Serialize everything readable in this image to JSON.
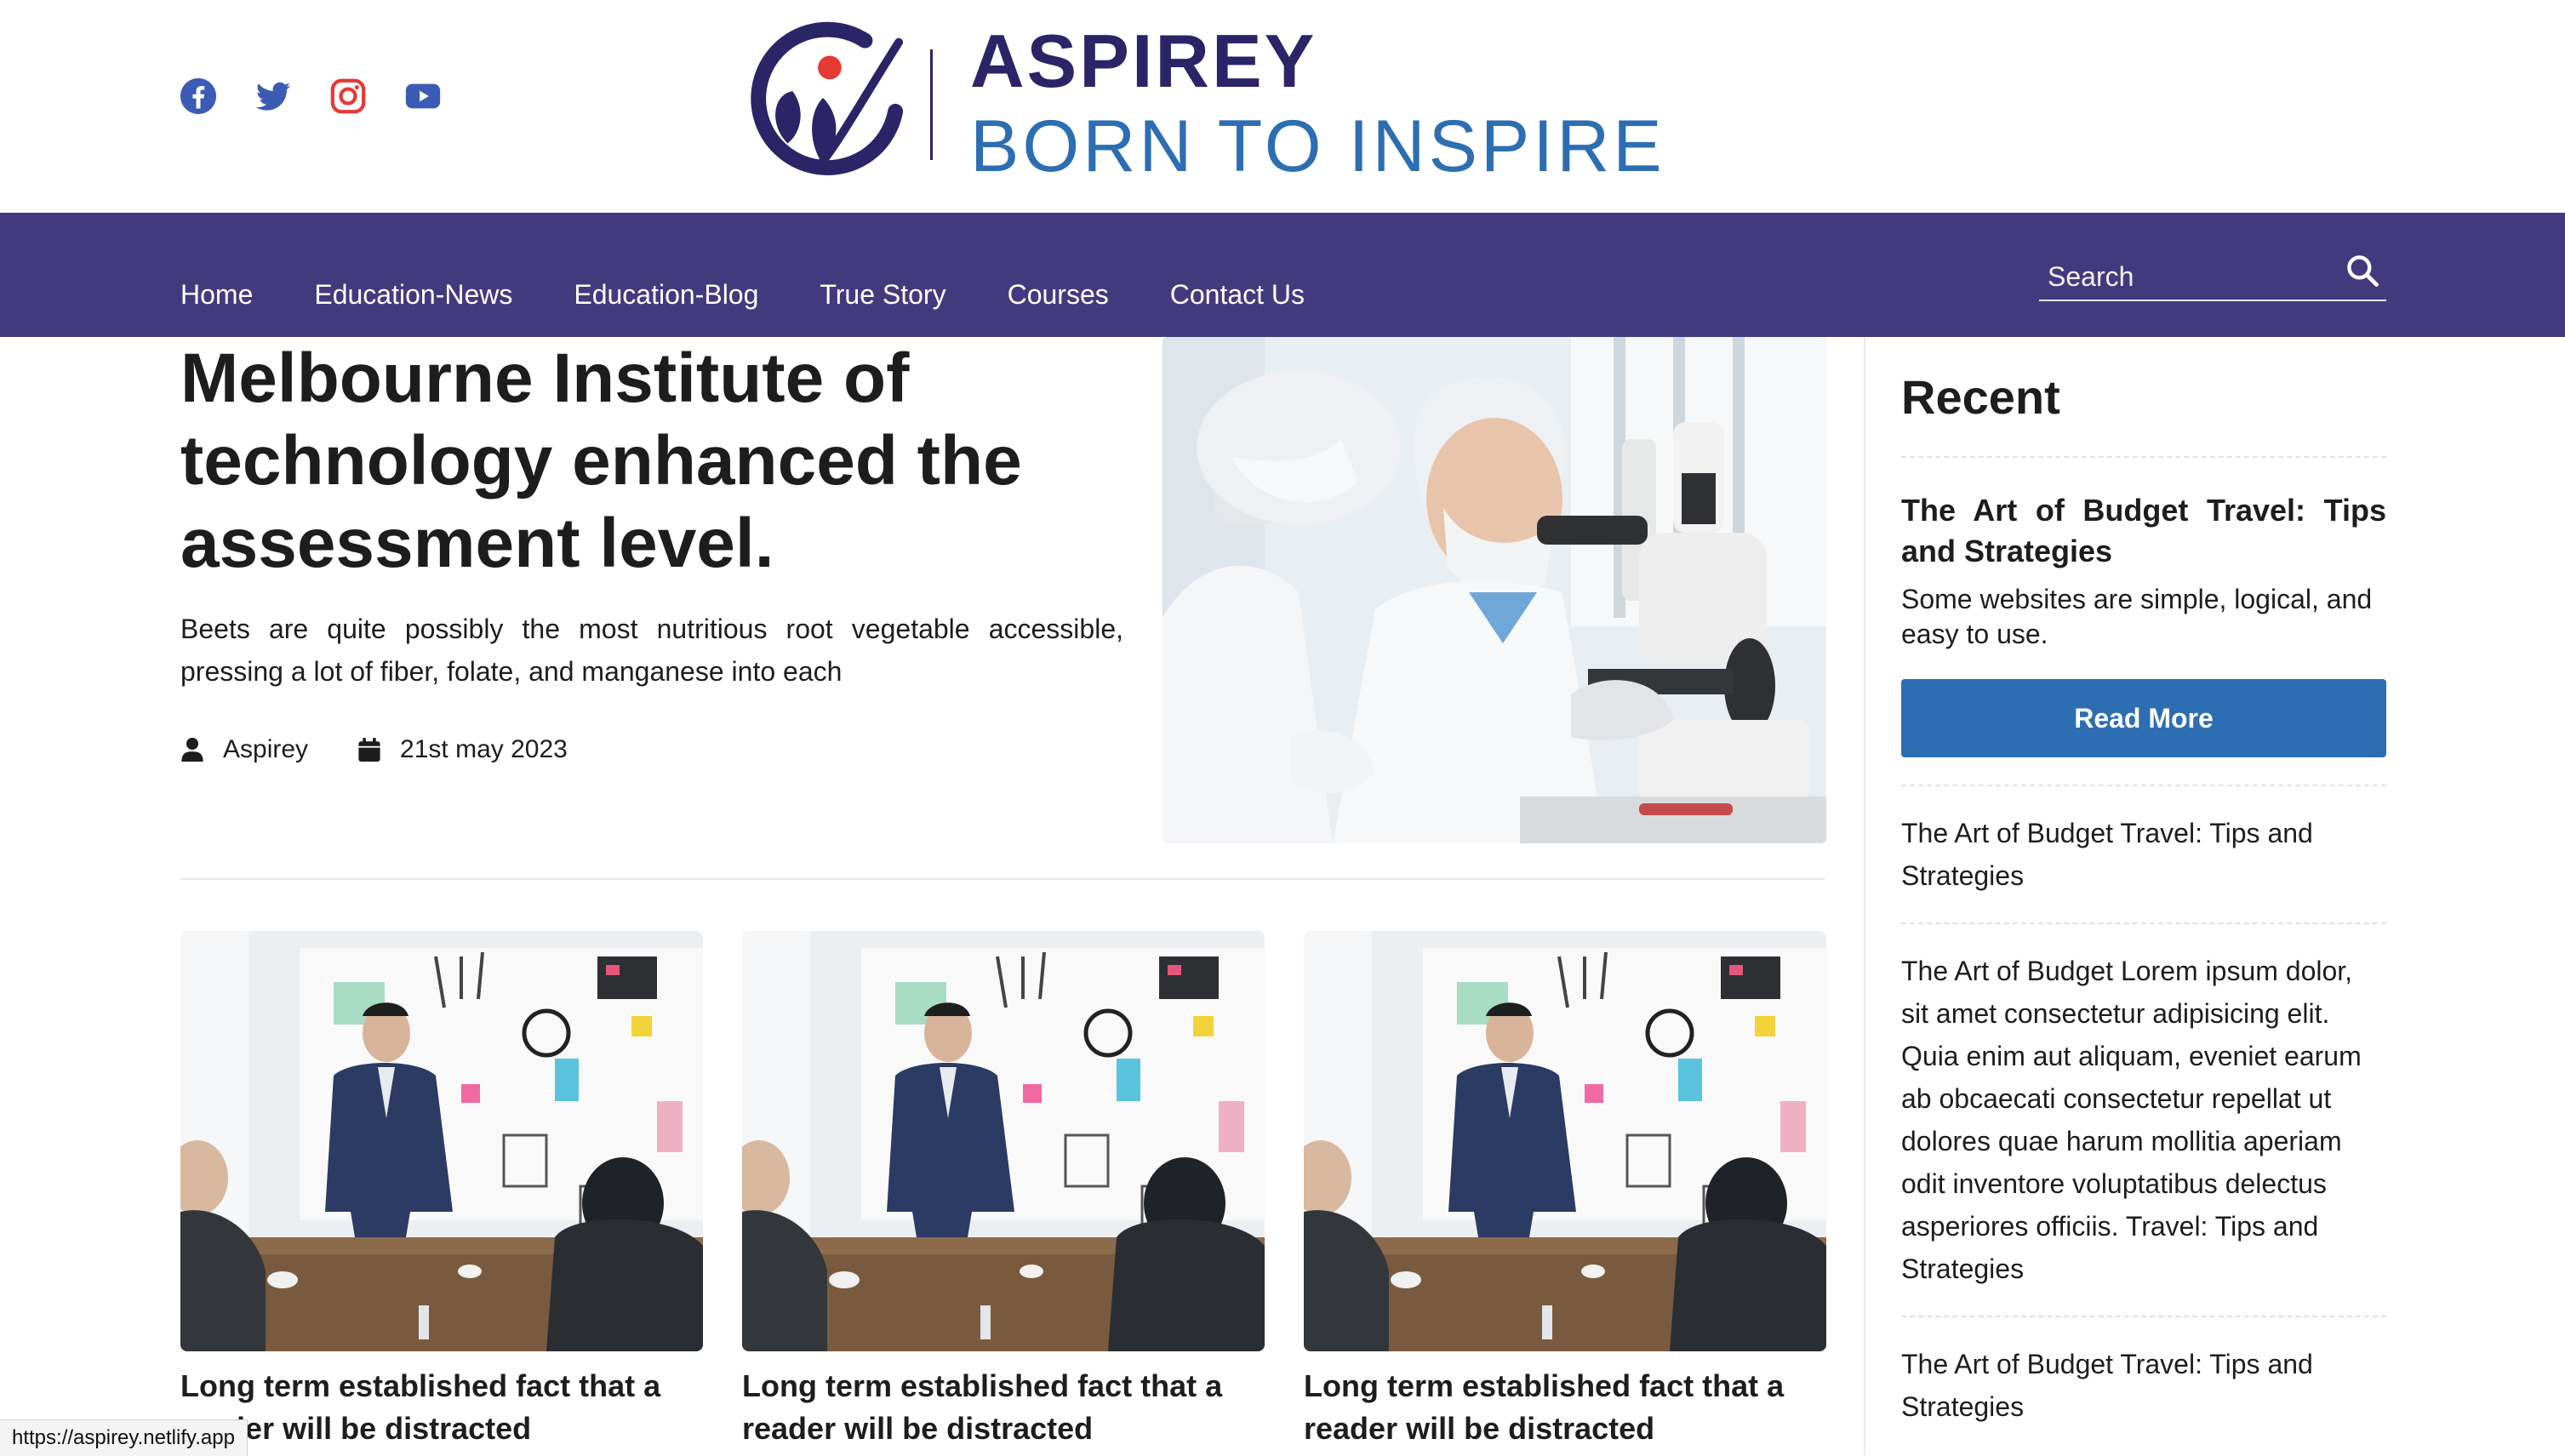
{
  "header": {
    "brand_name": "ASPIREY",
    "tagline": "BORN TO INSPIRE",
    "social": [
      "facebook-icon",
      "twitter-icon",
      "instagram-icon",
      "youtube-icon"
    ]
  },
  "nav": {
    "items": [
      {
        "label": "Home"
      },
      {
        "label": "Education-News"
      },
      {
        "label": "Education-Blog"
      },
      {
        "label": "True Story"
      },
      {
        "label": "Courses"
      },
      {
        "label": "Contact Us"
      }
    ],
    "search_placeholder": "Search"
  },
  "hero": {
    "title": "Melbourne Institute of technology enhanced the assessment level.",
    "description": "Beets are quite possibly the most nutritious root vegetable accessible, pressing a lot of fiber, folate, and manganese into each",
    "author": "Aspirey",
    "date": "21st may 2023"
  },
  "cards": [
    {
      "title": "Long term established fact that a reader will be distracted"
    },
    {
      "title": "Long term established fact that a reader will be distracted"
    },
    {
      "title": "Long term established fact that a reader will be distracted"
    }
  ],
  "sidebar": {
    "heading": "Recent",
    "featured": {
      "title": "The Art of Budget Travel: Tips and Strategies",
      "excerpt": "Some websites are simple, logical, and easy to use.",
      "button": "Read More"
    },
    "links": [
      {
        "text": "The Art of Budget Travel: Tips and Strategies"
      },
      {
        "text": "The Art of Budget Lorem ipsum dolor, sit amet consectetur adipisicing elit. Quia enim aut aliquam, eveniet earum ab obcaecati consectetur repellat ut dolores quae harum mollitia aperiam odit inventore voluptatibus delectus asperiores officiis. Travel: Tips and Strategies"
      },
      {
        "text": "The Art of Budget Travel: Tips and Strategies"
      }
    ]
  },
  "status_bar": {
    "url": "https://aspirey.netlify.app"
  },
  "colors": {
    "nav_bg": "#433a7e",
    "brand_dark": "#2b2467",
    "brand_blue": "#2d6eb3",
    "accent_red": "#e53935"
  }
}
